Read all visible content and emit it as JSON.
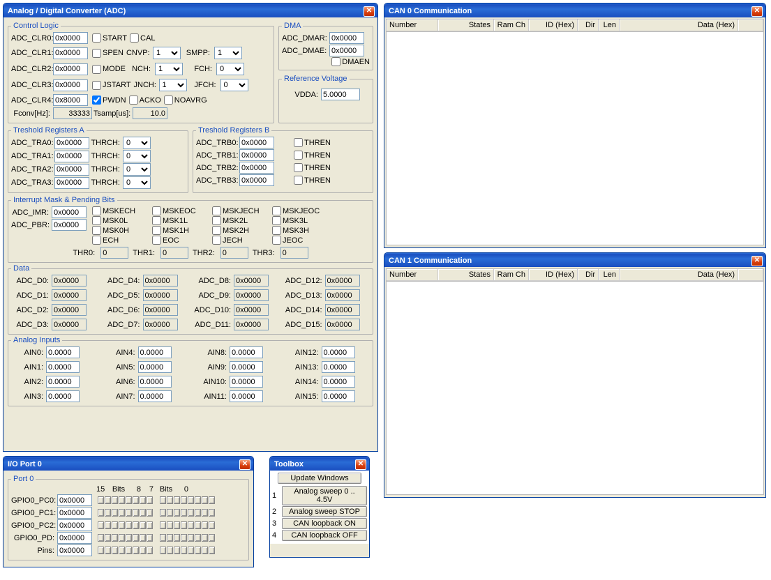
{
  "adc": {
    "title": "Analog / Digital Converter (ADC)",
    "control_logic": {
      "legend": "Control Logic",
      "clr": [
        {
          "label": "ADC_CLR0:",
          "value": "0x0000"
        },
        {
          "label": "ADC_CLR1:",
          "value": "0x0000"
        },
        {
          "label": "ADC_CLR2:",
          "value": "0x0000"
        },
        {
          "label": "ADC_CLR3:",
          "value": "0x0000"
        },
        {
          "label": "ADC_CLR4:",
          "value": "0x8000"
        }
      ],
      "cb_start": "START",
      "cb_cal": "CAL",
      "cb_spen": "SPEN",
      "cnvp_label": "CNVP:",
      "cnvp": "1",
      "smpp_label": "SMPP:",
      "smpp": "1",
      "cb_mode": "MODE",
      "nch_label": "NCH:",
      "nch": "1",
      "fch_label": "FCH:",
      "fch": "0",
      "cb_jstart": "JSTART",
      "jnch_label": "JNCH:",
      "jnch": "1",
      "jfch_label": "JFCH:",
      "jfch": "0",
      "cb_pwdn": "PWDN",
      "cb_acko": "ACKO",
      "cb_noavrg": "NOAVRG",
      "fconv_label": "Fconv[Hz]:",
      "fconv": "33333",
      "tsamp_label": "Tsamp[us]:",
      "tsamp": "10.0"
    },
    "dma": {
      "legend": "DMA",
      "dmar_label": "ADC_DMAR:",
      "dmar": "0x0000",
      "dmae_label": "ADC_DMAE:",
      "dmae": "0x0000",
      "cb_dmaen": "DMAEN"
    },
    "refv": {
      "legend": "Reference Voltage",
      "vdda_label": "VDDA:",
      "vdda": "5.0000"
    },
    "tra": {
      "legend": "Treshold Registers A",
      "rows": [
        {
          "label": "ADC_TRA0:",
          "value": "0x0000",
          "thrch_label": "THRCH:",
          "thrch": "0"
        },
        {
          "label": "ADC_TRA1:",
          "value": "0x0000",
          "thrch_label": "THRCH:",
          "thrch": "0"
        },
        {
          "label": "ADC_TRA2:",
          "value": "0x0000",
          "thrch_label": "THRCH:",
          "thrch": "0"
        },
        {
          "label": "ADC_TRA3:",
          "value": "0x0000",
          "thrch_label": "THRCH:",
          "thrch": "0"
        }
      ]
    },
    "trb": {
      "legend": "Treshold Registers B",
      "rows": [
        {
          "label": "ADC_TRB0:",
          "value": "0x0000",
          "thren": "THREN"
        },
        {
          "label": "ADC_TRB1:",
          "value": "0x0000",
          "thren": "THREN"
        },
        {
          "label": "ADC_TRB2:",
          "value": "0x0000",
          "thren": "THREN"
        },
        {
          "label": "ADC_TRB3:",
          "value": "0x0000",
          "thren": "THREN"
        }
      ]
    },
    "imr": {
      "legend": "Interrupt Mask & Pending Bits",
      "imr_label": "ADC_IMR:",
      "imr": "0x0000",
      "pbr_label": "ADC_PBR:",
      "pbr": "0x0000",
      "grid": [
        [
          "MSKECH",
          "MSKEOC",
          "MSKJECH",
          "MSKJEOC"
        ],
        [
          "MSK0L",
          "MSK1L",
          "MSK2L",
          "MSK3L"
        ],
        [
          "MSK0H",
          "MSK1H",
          "MSK2H",
          "MSK3H"
        ],
        [
          "ECH",
          "EOC",
          "JECH",
          "JEOC"
        ]
      ],
      "thr_labels": [
        "THR0:",
        "THR1:",
        "THR2:",
        "THR3:"
      ],
      "thr_vals": [
        "0",
        "0",
        "0",
        "0"
      ]
    },
    "data": {
      "legend": "Data",
      "items": [
        {
          "label": "ADC_D0:",
          "v": "0x0000"
        },
        {
          "label": "ADC_D4:",
          "v": "0x0000"
        },
        {
          "label": "ADC_D8:",
          "v": "0x0000"
        },
        {
          "label": "ADC_D12:",
          "v": "0x0000"
        },
        {
          "label": "ADC_D1:",
          "v": "0x0000"
        },
        {
          "label": "ADC_D5:",
          "v": "0x0000"
        },
        {
          "label": "ADC_D9:",
          "v": "0x0000"
        },
        {
          "label": "ADC_D13:",
          "v": "0x0000"
        },
        {
          "label": "ADC_D2:",
          "v": "0x0000"
        },
        {
          "label": "ADC_D6:",
          "v": "0x0000"
        },
        {
          "label": "ADC_D10:",
          "v": "0x0000"
        },
        {
          "label": "ADC_D14:",
          "v": "0x0000"
        },
        {
          "label": "ADC_D3:",
          "v": "0x0000"
        },
        {
          "label": "ADC_D7:",
          "v": "0x0000"
        },
        {
          "label": "ADC_D11:",
          "v": "0x0000"
        },
        {
          "label": "ADC_D15:",
          "v": "0x0000"
        }
      ]
    },
    "ain": {
      "legend": "Analog Inputs",
      "items": [
        {
          "label": "AIN0:",
          "v": "0.0000"
        },
        {
          "label": "AIN4:",
          "v": "0.0000"
        },
        {
          "label": "AIN8:",
          "v": "0.0000"
        },
        {
          "label": "AIN12:",
          "v": "0.0000"
        },
        {
          "label": "AIN1:",
          "v": "0.0000"
        },
        {
          "label": "AIN5:",
          "v": "0.0000"
        },
        {
          "label": "AIN9:",
          "v": "0.0000"
        },
        {
          "label": "AIN13:",
          "v": "0.0000"
        },
        {
          "label": "AIN2:",
          "v": "0.0000"
        },
        {
          "label": "AIN6:",
          "v": "0.0000"
        },
        {
          "label": "AIN10:",
          "v": "0.0000"
        },
        {
          "label": "AIN14:",
          "v": "0.0000"
        },
        {
          "label": "AIN3:",
          "v": "0.0000"
        },
        {
          "label": "AIN7:",
          "v": "0.0000"
        },
        {
          "label": "AIN11:",
          "v": "0.0000"
        },
        {
          "label": "AIN15:",
          "v": "0.0000"
        }
      ]
    }
  },
  "can0": {
    "title": "CAN 0 Communication",
    "cols": [
      "Number",
      "States",
      "Ram Ch",
      "ID (Hex)",
      "Dir",
      "Len",
      "Data (Hex)"
    ]
  },
  "can1": {
    "title": "CAN 1 Communication",
    "cols": [
      "Number",
      "States",
      "Ram Ch",
      "ID (Hex)",
      "Dir",
      "Len",
      "Data (Hex)"
    ]
  },
  "io": {
    "title": "I/O Port 0",
    "legend": "Port 0",
    "bits15": "15",
    "bitsl": "Bits",
    "bits8": "8",
    "bits7": "7",
    "bits0": "0",
    "rows": [
      {
        "label": "GPIO0_PC0:",
        "v": "0x0000"
      },
      {
        "label": "GPIO0_PC1:",
        "v": "0x0000"
      },
      {
        "label": "GPIO0_PC2:",
        "v": "0x0000"
      },
      {
        "label": "GPIO0_PD:",
        "v": "0x0000"
      },
      {
        "label": "Pins:",
        "v": "0x0000"
      }
    ]
  },
  "toolbox": {
    "title": "Toolbox",
    "update": "Update Windows",
    "items": [
      {
        "n": "1",
        "t": "Analog sweep 0 .. 4.5V"
      },
      {
        "n": "2",
        "t": "Analog sweep STOP"
      },
      {
        "n": "3",
        "t": "CAN loopback ON"
      },
      {
        "n": "4",
        "t": "CAN loopback OFF"
      }
    ]
  }
}
